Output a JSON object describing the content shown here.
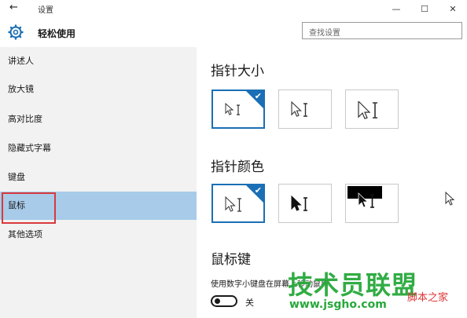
{
  "window": {
    "title": "设置",
    "back_symbol": "←",
    "buttons": [
      "—",
      "☐",
      "✕"
    ]
  },
  "header": {
    "heading": "轻松使用",
    "search_placeholder": "查找设置"
  },
  "sidebar": {
    "items": [
      {
        "label": "讲述人"
      },
      {
        "label": "放大镜"
      },
      {
        "label": "高对比度"
      },
      {
        "label": "隐藏式字幕"
      },
      {
        "label": "键盘"
      },
      {
        "label": "鼠标"
      },
      {
        "label": "其他选项"
      }
    ],
    "selected_index": 5
  },
  "main": {
    "pointer_size_title": "指针大小",
    "pointer_color_title": "指针颜色",
    "mouse_keys_title": "鼠标键",
    "mouse_keys_desc": "使用数字小键盘在屏幕上移动鼠标",
    "toggle_state_label": "关",
    "check_symbol": "✔"
  },
  "watermark": {
    "main": "技术员联盟",
    "url": "www.jsgho.com",
    "sub": "脚本之家"
  },
  "colors": {
    "accent": "#1a6fb5",
    "selected_nav": "#a7cbe9",
    "sidebar_bg": "#f2f2f2",
    "focus_outline": "#d9393e",
    "watermark": "#27a83a"
  }
}
